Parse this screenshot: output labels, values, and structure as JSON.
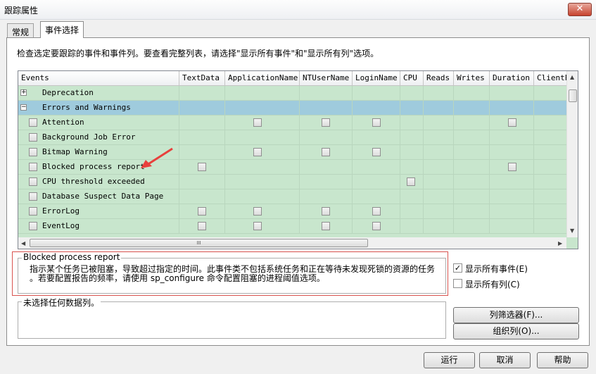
{
  "window": {
    "title": "跟踪属性",
    "close_label": "✕"
  },
  "tabs": [
    {
      "label": "常规"
    },
    {
      "label": "事件选择"
    }
  ],
  "description": "检查选定要跟踪的事件和事件列。要查看完整列表，请选择\"显示所有事件\"和\"显示所有列\"选项。",
  "grid": {
    "columns": [
      "Events",
      "TextData",
      "ApplicationName",
      "NTUserName",
      "LoginName",
      "CPU",
      "Reads",
      "Writes",
      "Duration",
      "ClientP"
    ],
    "rows": [
      {
        "label": "Deprecation",
        "type": "category",
        "expander": "+",
        "checks": []
      },
      {
        "label": "Errors and Warnings",
        "type": "category",
        "expander": "−",
        "selected": true,
        "checks": []
      },
      {
        "label": "Attention",
        "type": "event",
        "checks": [
          "ApplicationName",
          "NTUserName",
          "LoginName",
          "Duration"
        ]
      },
      {
        "label": "Background Job Error",
        "type": "event",
        "checks": []
      },
      {
        "label": "Bitmap Warning",
        "type": "event",
        "checks": [
          "ApplicationName",
          "NTUserName",
          "LoginName"
        ]
      },
      {
        "label": "Blocked process report",
        "type": "event",
        "checks": [
          "TextData",
          "Duration"
        ]
      },
      {
        "label": "CPU threshold exceeded",
        "type": "event",
        "checks": [
          "CPU"
        ]
      },
      {
        "label": "Database Suspect Data Page",
        "type": "event",
        "checks": []
      },
      {
        "label": "ErrorLog",
        "type": "event",
        "checks": [
          "TextData",
          "ApplicationName",
          "NTUserName",
          "LoginName"
        ]
      },
      {
        "label": "EventLog",
        "type": "event",
        "checks": [
          "TextData",
          "ApplicationName",
          "NTUserName",
          "LoginName"
        ]
      }
    ],
    "hscroll_grip": "III"
  },
  "info": {
    "title": "Blocked process report",
    "line1": "指示某个任务已被阻塞，导致超过指定的时间。此事件类不包括系统任务和正在等待未发现死锁的资源的任务",
    "line2": "。若要配置报告的频率，请使用 sp_configure 命令配置阻塞的进程阈值选项。"
  },
  "column_info": {
    "title": "未选择任何数据列。"
  },
  "options": {
    "show_all_events": {
      "label": "显示所有事件(E)",
      "checked": true
    },
    "show_all_columns": {
      "label": "显示所有列(C)",
      "checked": false
    }
  },
  "buttons": {
    "column_filters": "列筛选器(F)...",
    "organize_columns": "组织列(O)...",
    "run": "运行",
    "cancel": "取消",
    "help": "帮助"
  },
  "colors": {
    "grid_bg": "#c8e6cd",
    "selected_row": "#9fcbdd",
    "arrow": "#e8403c",
    "info_border": "#d9534f"
  }
}
